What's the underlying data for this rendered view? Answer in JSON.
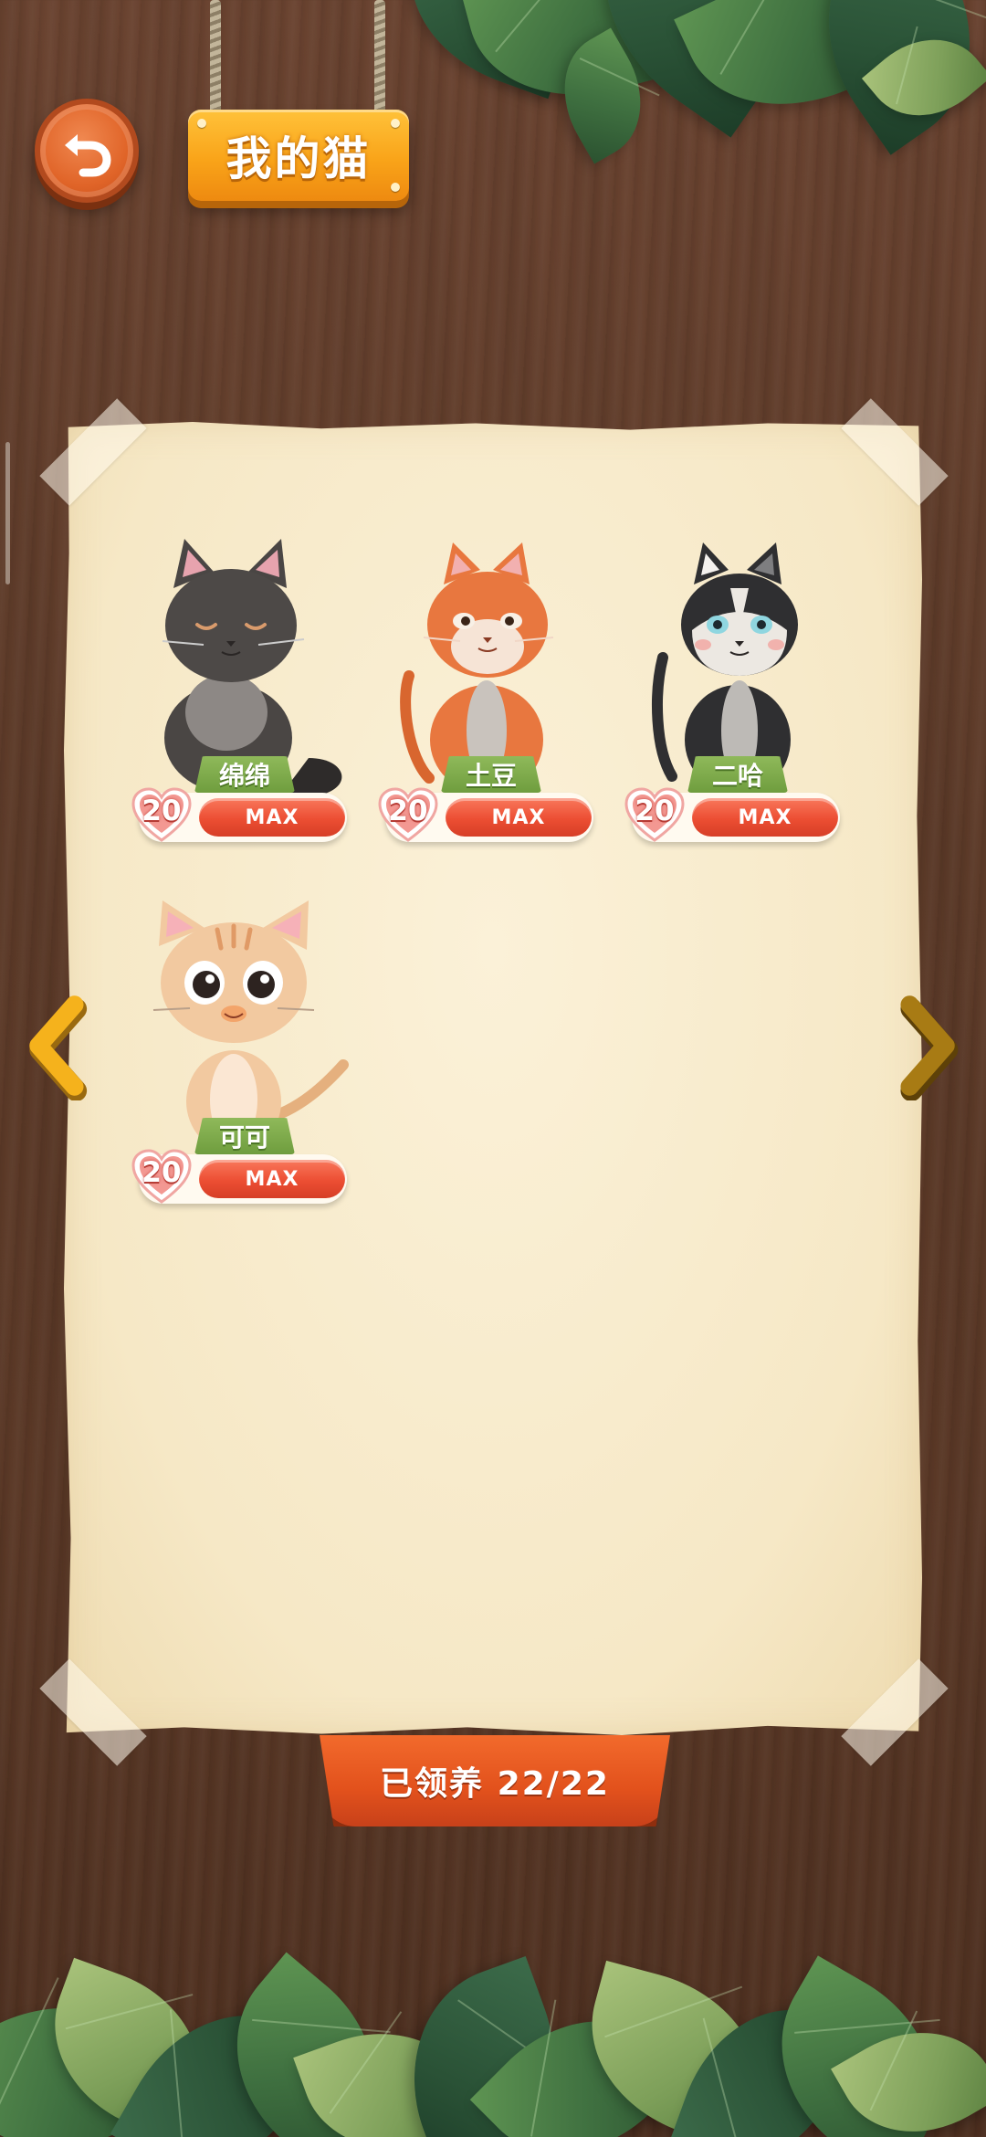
{
  "header": {
    "back_label": "返回",
    "title": "我的猫"
  },
  "cats": [
    {
      "name": "绵绵",
      "level": "20",
      "status": "MAX",
      "fur": "#4a4644",
      "belly": "#8d8885",
      "style": "fluffy"
    },
    {
      "name": "土豆",
      "level": "20",
      "status": "MAX",
      "fur": "#e8773f",
      "belly": "#f6e4d6",
      "style": "orange"
    },
    {
      "name": "二哈",
      "level": "20",
      "status": "MAX",
      "fur": "#2f2f31",
      "belly": "#ece8e2",
      "style": "husky"
    },
    {
      "name": "可可",
      "level": "20",
      "status": "MAX",
      "fur": "#f2c9a0",
      "belly": "#fbe7d3",
      "style": "kitten"
    }
  ],
  "navigation": {
    "prev_icon": "chevron-left-icon",
    "next_icon": "chevron-right-icon"
  },
  "footer": {
    "claimed_text": "已领养 22/22"
  },
  "colors": {
    "accent_orange": "#e2511c",
    "title_gold": "#f9a419",
    "tag_green": "#6f9d3e",
    "pill_red": "#ec4e33"
  }
}
